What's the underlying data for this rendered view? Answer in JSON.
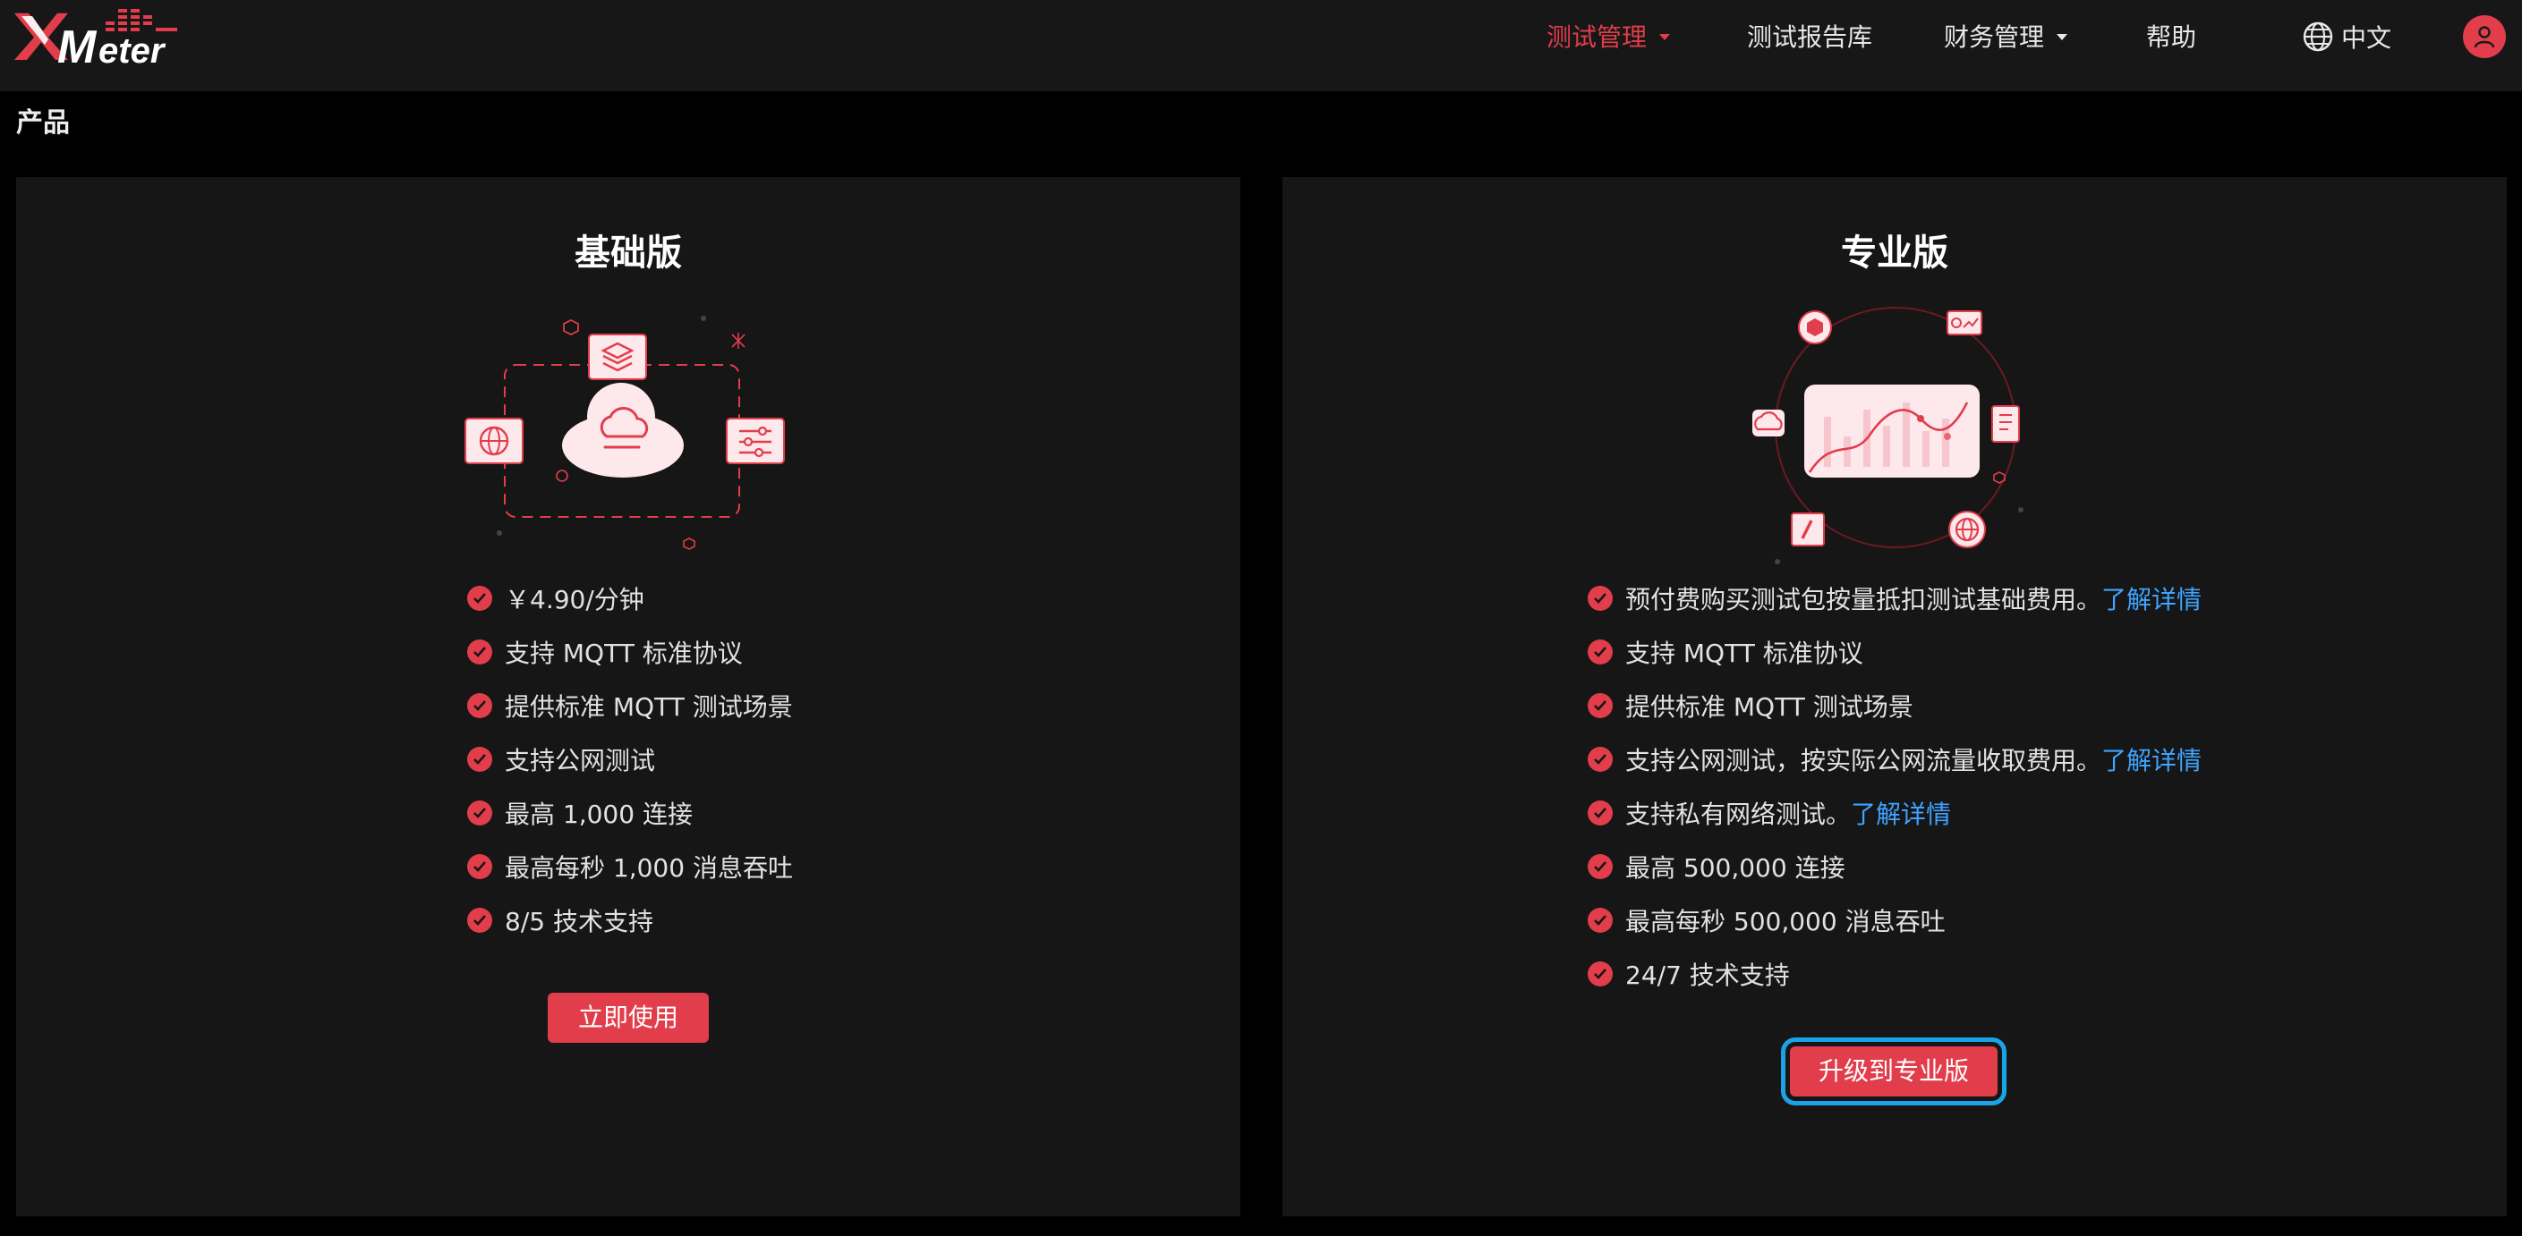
{
  "logo": {
    "text": "XMeter",
    "icon": "xmeter-logo"
  },
  "nav": {
    "items": [
      {
        "label": "测试管理",
        "active": true,
        "dropdown": true
      },
      {
        "label": "测试报告库",
        "active": false,
        "dropdown": false
      },
      {
        "label": "财务管理",
        "active": false,
        "dropdown": true
      },
      {
        "label": "帮助",
        "active": false,
        "dropdown": false
      }
    ],
    "language": "中文",
    "language_icon": "globe-icon",
    "user_icon": "user-avatar-icon"
  },
  "page": {
    "title": "产品"
  },
  "plans": {
    "basic": {
      "title": "基础版",
      "features": [
        {
          "text": "￥4.90/分钟"
        },
        {
          "text": "支持 MQTT 标准协议"
        },
        {
          "text": "提供标准 MQTT 测试场景"
        },
        {
          "text": "支持公网测试"
        },
        {
          "text": "最高 1,000 连接"
        },
        {
          "text": "最高每秒 1,000 消息吞吐"
        },
        {
          "text": "8/5 技术支持"
        }
      ],
      "button": "立即使用"
    },
    "pro": {
      "title": "专业版",
      "features": [
        {
          "text": "预付费购买测试包按量抵扣测试基础费用。",
          "link": "了解详情"
        },
        {
          "text": "支持 MQTT 标准协议"
        },
        {
          "text": "提供标准 MQTT 测试场景"
        },
        {
          "text": "支持公网测试，按实际公网流量收取费用。",
          "link": "了解详情"
        },
        {
          "text": "支持私有网络测试。",
          "link": "了解详情"
        },
        {
          "text": "最高 500,000 连接"
        },
        {
          "text": "最高每秒 500,000 消息吞吐"
        },
        {
          "text": "24/7 技术支持"
        }
      ],
      "button": "升级到专业版"
    }
  },
  "colors": {
    "accent": "#e23d4b",
    "link": "#3fa3ff",
    "focus": "#1aa3e8",
    "card": "#161616",
    "topbar": "#171717"
  }
}
